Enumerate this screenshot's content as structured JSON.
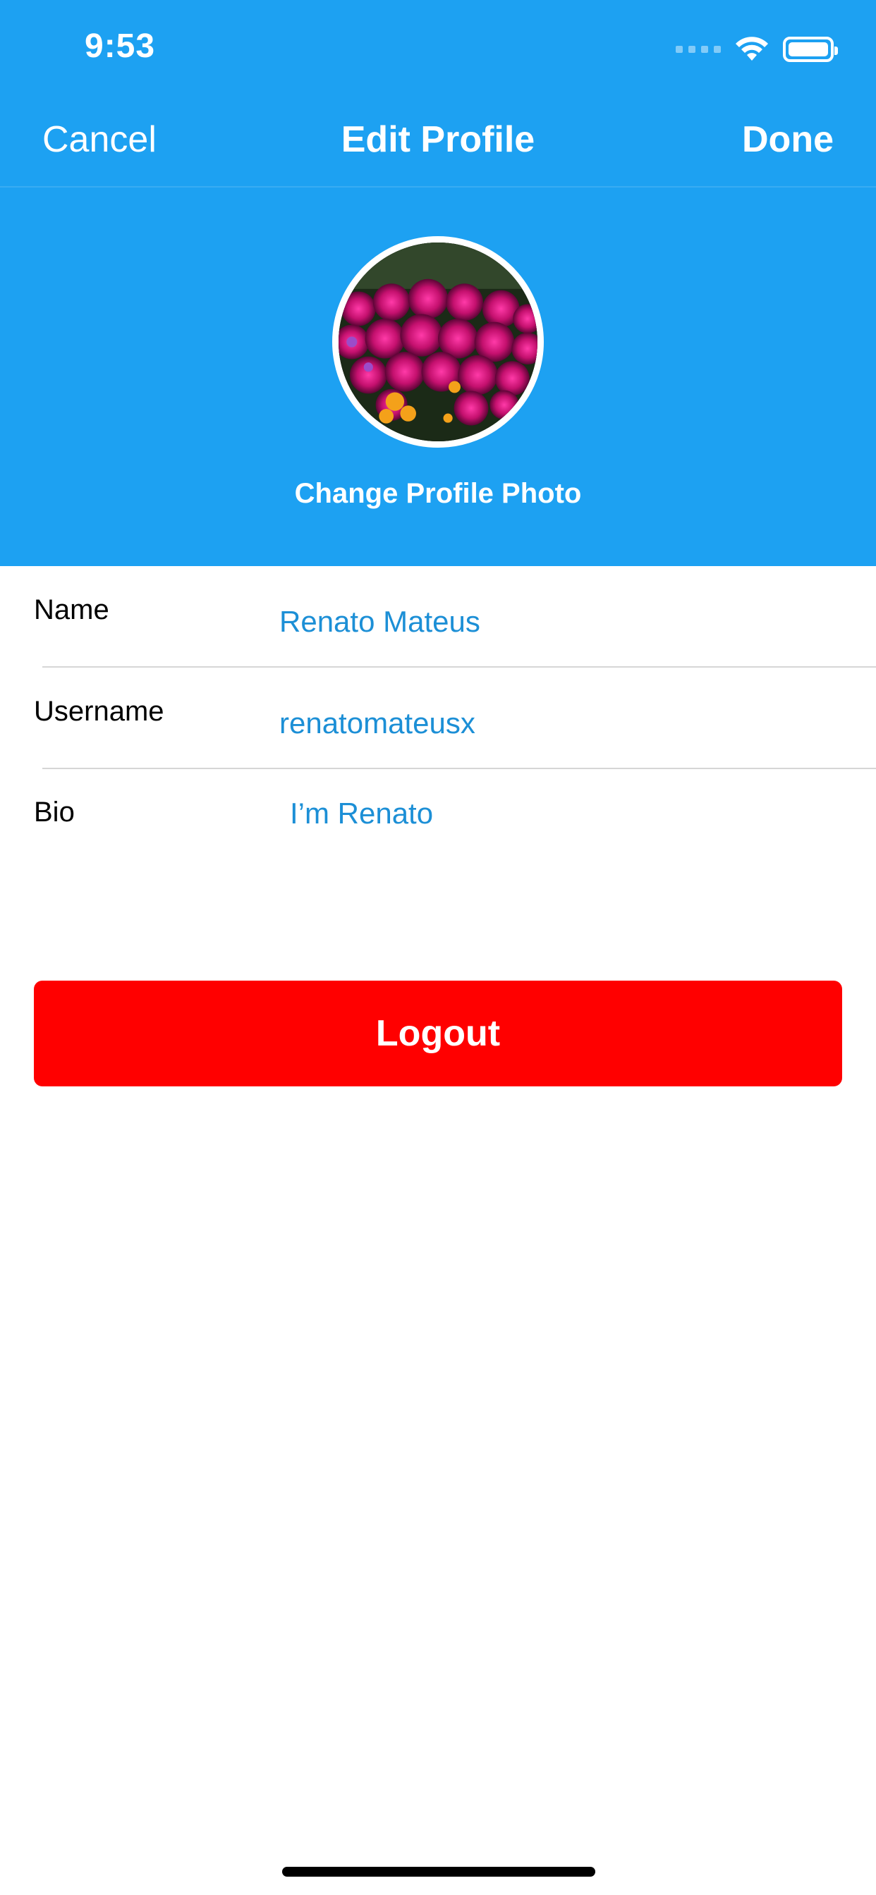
{
  "status_bar": {
    "time": "9:53"
  },
  "nav": {
    "cancel_label": "Cancel",
    "title": "Edit Profile",
    "done_label": "Done"
  },
  "profile_photo": {
    "change_label": "Change Profile Photo"
  },
  "form": {
    "name_label": "Name",
    "name_value": "Renato Mateus",
    "username_label": "Username",
    "username_value": "renatomateusx",
    "bio_label": "Bio",
    "bio_value": "I’m Renato"
  },
  "logout_label": "Logout",
  "colors": {
    "header_bg": "#1da1f2",
    "value_text": "#1c8fd6",
    "logout_bg": "#ff0000",
    "divider": "#d6d6d6"
  }
}
